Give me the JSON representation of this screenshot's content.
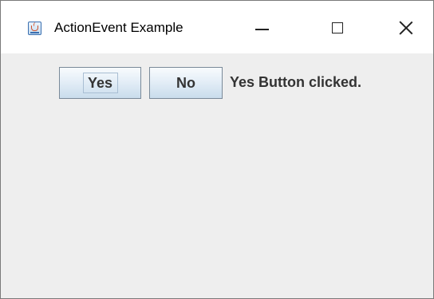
{
  "window": {
    "title": "ActionEvent Example",
    "icon": "java-coffee-cup-icon",
    "controls": {
      "minimize": "minimize-icon",
      "maximize": "maximize-icon",
      "close": "close-icon"
    }
  },
  "buttons": {
    "yes_label": "Yes",
    "no_label": "No"
  },
  "status_text": "Yes Button clicked.",
  "colors": {
    "panel_background": "#eeeeee",
    "titlebar_background": "#ffffff",
    "text": "#333333"
  }
}
